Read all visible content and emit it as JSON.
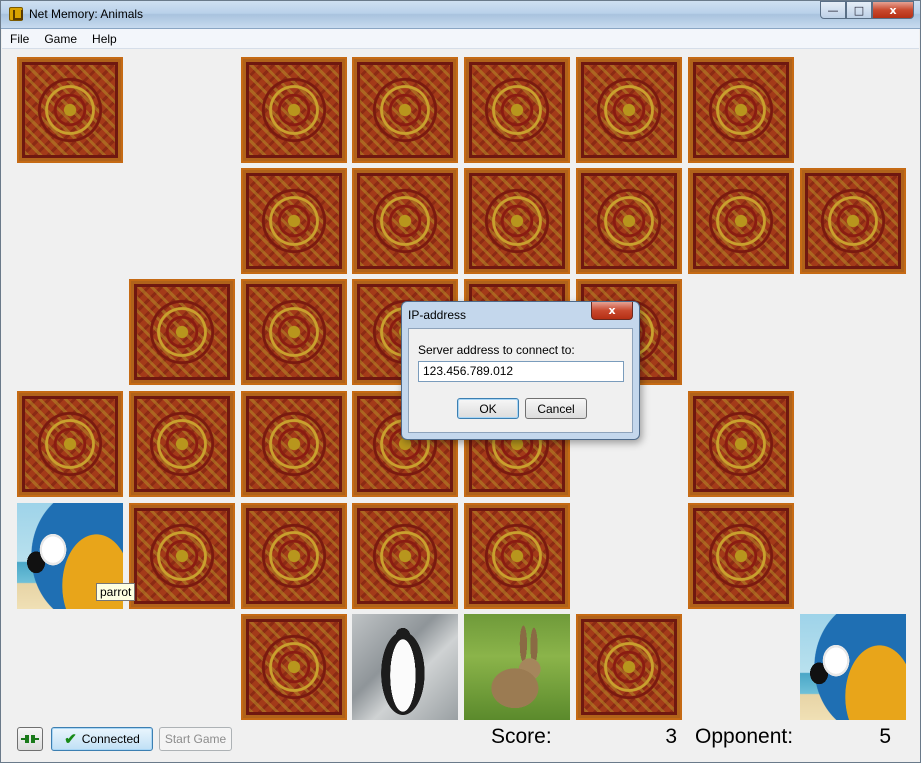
{
  "window": {
    "title": "Net Memory: Animals",
    "controls": {
      "minimize": "—",
      "maximize": "□",
      "close": "x"
    }
  },
  "menu": [
    "File",
    "Game",
    "Help"
  ],
  "board": {
    "hidden_tiles": 30,
    "revealed": [
      {
        "animal": "parrot",
        "icon": "parrot-photo"
      },
      {
        "animal": "penguin",
        "icon": "penguin-photo"
      },
      {
        "animal": "rabbit",
        "icon": "rabbit-photo"
      },
      {
        "animal": "parrot",
        "icon": "parrot-photo"
      }
    ],
    "tooltip": "parrot"
  },
  "dialog": {
    "title": "IP-address",
    "close": "x",
    "label": "Server address to connect to:",
    "input_value": "123.456.789.012",
    "ok": "OK",
    "cancel": "Cancel"
  },
  "toolbar": {
    "connect_icon": "plug-icon",
    "connected_label": "Connected",
    "start_label": "Start Game"
  },
  "score": {
    "label": "Score:",
    "value": "3",
    "opponent_label": "Opponent:",
    "opponent_value": "5"
  }
}
